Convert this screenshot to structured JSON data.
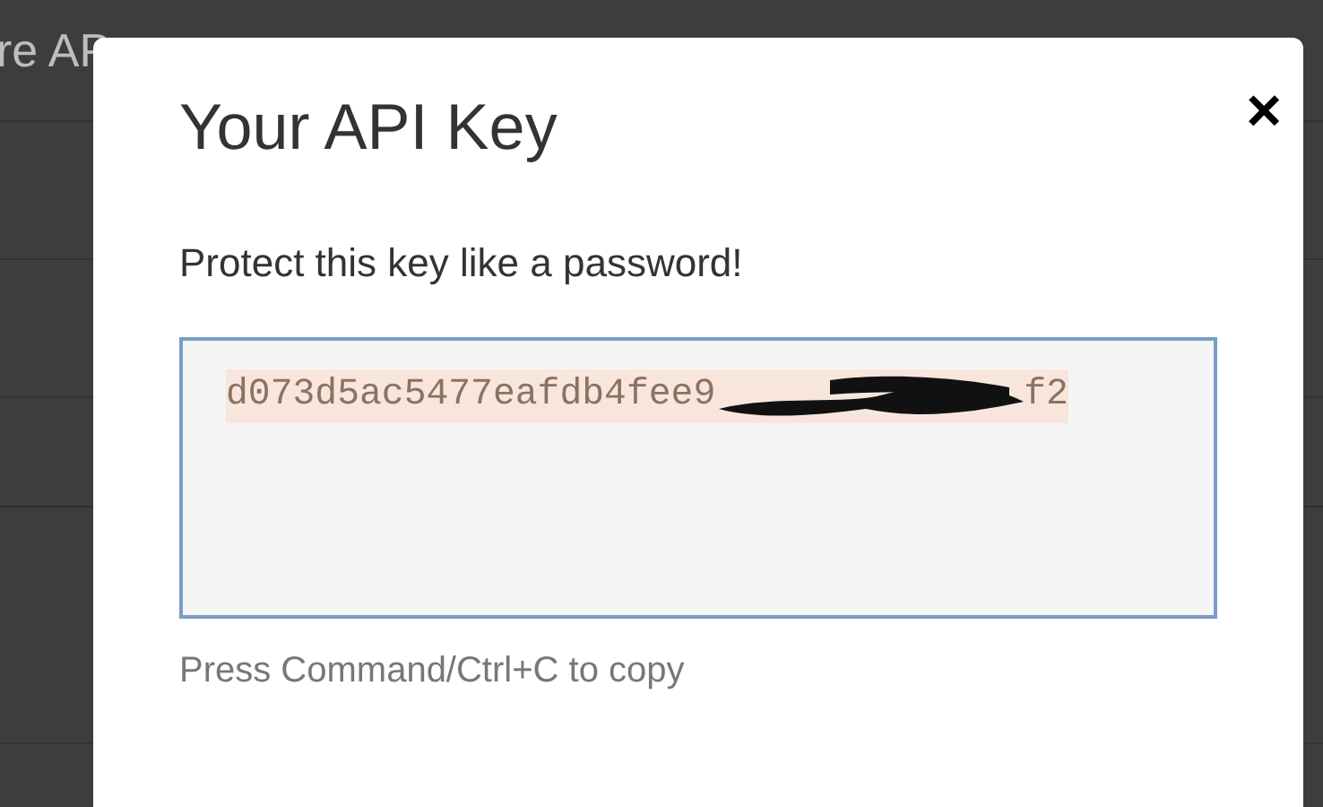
{
  "background_page": {
    "heading": "re AP"
  },
  "dialog": {
    "title": "Your API Key",
    "close": "×",
    "message": "Protect this key like a password!",
    "key_field": {
      "visible_start": "d073d5ac5477eafdb4fee9",
      "visible_end": "f2",
      "selected": true
    },
    "hint": "Press Command/Ctrl+C to copy"
  }
}
